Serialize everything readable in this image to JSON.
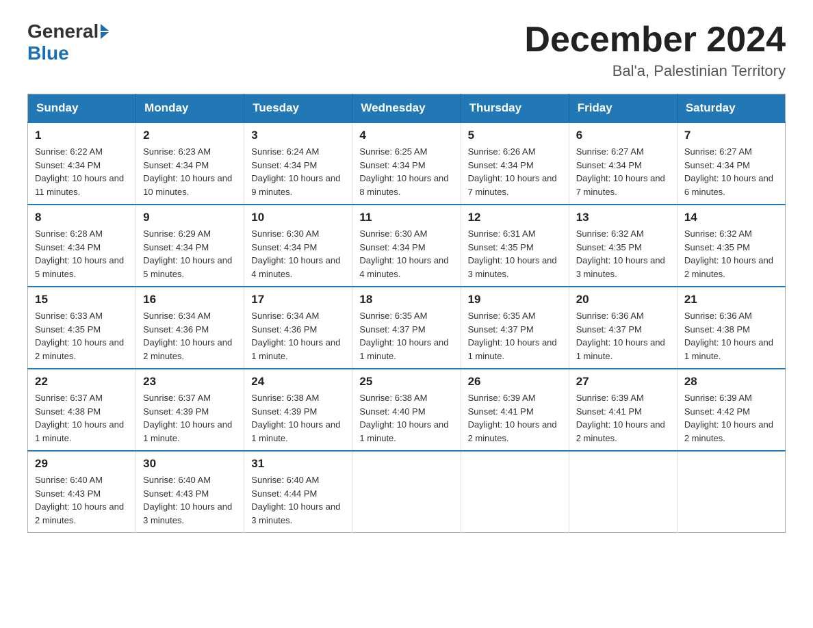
{
  "logo": {
    "text_general": "General",
    "text_blue": "Blue"
  },
  "title": "December 2024",
  "subtitle": "Bal'a, Palestinian Territory",
  "days_of_week": [
    "Sunday",
    "Monday",
    "Tuesday",
    "Wednesday",
    "Thursday",
    "Friday",
    "Saturday"
  ],
  "weeks": [
    [
      {
        "day": "1",
        "sunrise": "6:22 AM",
        "sunset": "4:34 PM",
        "daylight": "10 hours and 11 minutes."
      },
      {
        "day": "2",
        "sunrise": "6:23 AM",
        "sunset": "4:34 PM",
        "daylight": "10 hours and 10 minutes."
      },
      {
        "day": "3",
        "sunrise": "6:24 AM",
        "sunset": "4:34 PM",
        "daylight": "10 hours and 9 minutes."
      },
      {
        "day": "4",
        "sunrise": "6:25 AM",
        "sunset": "4:34 PM",
        "daylight": "10 hours and 8 minutes."
      },
      {
        "day": "5",
        "sunrise": "6:26 AM",
        "sunset": "4:34 PM",
        "daylight": "10 hours and 7 minutes."
      },
      {
        "day": "6",
        "sunrise": "6:27 AM",
        "sunset": "4:34 PM",
        "daylight": "10 hours and 7 minutes."
      },
      {
        "day": "7",
        "sunrise": "6:27 AM",
        "sunset": "4:34 PM",
        "daylight": "10 hours and 6 minutes."
      }
    ],
    [
      {
        "day": "8",
        "sunrise": "6:28 AM",
        "sunset": "4:34 PM",
        "daylight": "10 hours and 5 minutes."
      },
      {
        "day": "9",
        "sunrise": "6:29 AM",
        "sunset": "4:34 PM",
        "daylight": "10 hours and 5 minutes."
      },
      {
        "day": "10",
        "sunrise": "6:30 AM",
        "sunset": "4:34 PM",
        "daylight": "10 hours and 4 minutes."
      },
      {
        "day": "11",
        "sunrise": "6:30 AM",
        "sunset": "4:34 PM",
        "daylight": "10 hours and 4 minutes."
      },
      {
        "day": "12",
        "sunrise": "6:31 AM",
        "sunset": "4:35 PM",
        "daylight": "10 hours and 3 minutes."
      },
      {
        "day": "13",
        "sunrise": "6:32 AM",
        "sunset": "4:35 PM",
        "daylight": "10 hours and 3 minutes."
      },
      {
        "day": "14",
        "sunrise": "6:32 AM",
        "sunset": "4:35 PM",
        "daylight": "10 hours and 2 minutes."
      }
    ],
    [
      {
        "day": "15",
        "sunrise": "6:33 AM",
        "sunset": "4:35 PM",
        "daylight": "10 hours and 2 minutes."
      },
      {
        "day": "16",
        "sunrise": "6:34 AM",
        "sunset": "4:36 PM",
        "daylight": "10 hours and 2 minutes."
      },
      {
        "day": "17",
        "sunrise": "6:34 AM",
        "sunset": "4:36 PM",
        "daylight": "10 hours and 1 minute."
      },
      {
        "day": "18",
        "sunrise": "6:35 AM",
        "sunset": "4:37 PM",
        "daylight": "10 hours and 1 minute."
      },
      {
        "day": "19",
        "sunrise": "6:35 AM",
        "sunset": "4:37 PM",
        "daylight": "10 hours and 1 minute."
      },
      {
        "day": "20",
        "sunrise": "6:36 AM",
        "sunset": "4:37 PM",
        "daylight": "10 hours and 1 minute."
      },
      {
        "day": "21",
        "sunrise": "6:36 AM",
        "sunset": "4:38 PM",
        "daylight": "10 hours and 1 minute."
      }
    ],
    [
      {
        "day": "22",
        "sunrise": "6:37 AM",
        "sunset": "4:38 PM",
        "daylight": "10 hours and 1 minute."
      },
      {
        "day": "23",
        "sunrise": "6:37 AM",
        "sunset": "4:39 PM",
        "daylight": "10 hours and 1 minute."
      },
      {
        "day": "24",
        "sunrise": "6:38 AM",
        "sunset": "4:39 PM",
        "daylight": "10 hours and 1 minute."
      },
      {
        "day": "25",
        "sunrise": "6:38 AM",
        "sunset": "4:40 PM",
        "daylight": "10 hours and 1 minute."
      },
      {
        "day": "26",
        "sunrise": "6:39 AM",
        "sunset": "4:41 PM",
        "daylight": "10 hours and 2 minutes."
      },
      {
        "day": "27",
        "sunrise": "6:39 AM",
        "sunset": "4:41 PM",
        "daylight": "10 hours and 2 minutes."
      },
      {
        "day": "28",
        "sunrise": "6:39 AM",
        "sunset": "4:42 PM",
        "daylight": "10 hours and 2 minutes."
      }
    ],
    [
      {
        "day": "29",
        "sunrise": "6:40 AM",
        "sunset": "4:43 PM",
        "daylight": "10 hours and 2 minutes."
      },
      {
        "day": "30",
        "sunrise": "6:40 AM",
        "sunset": "4:43 PM",
        "daylight": "10 hours and 3 minutes."
      },
      {
        "day": "31",
        "sunrise": "6:40 AM",
        "sunset": "4:44 PM",
        "daylight": "10 hours and 3 minutes."
      },
      null,
      null,
      null,
      null
    ]
  ]
}
